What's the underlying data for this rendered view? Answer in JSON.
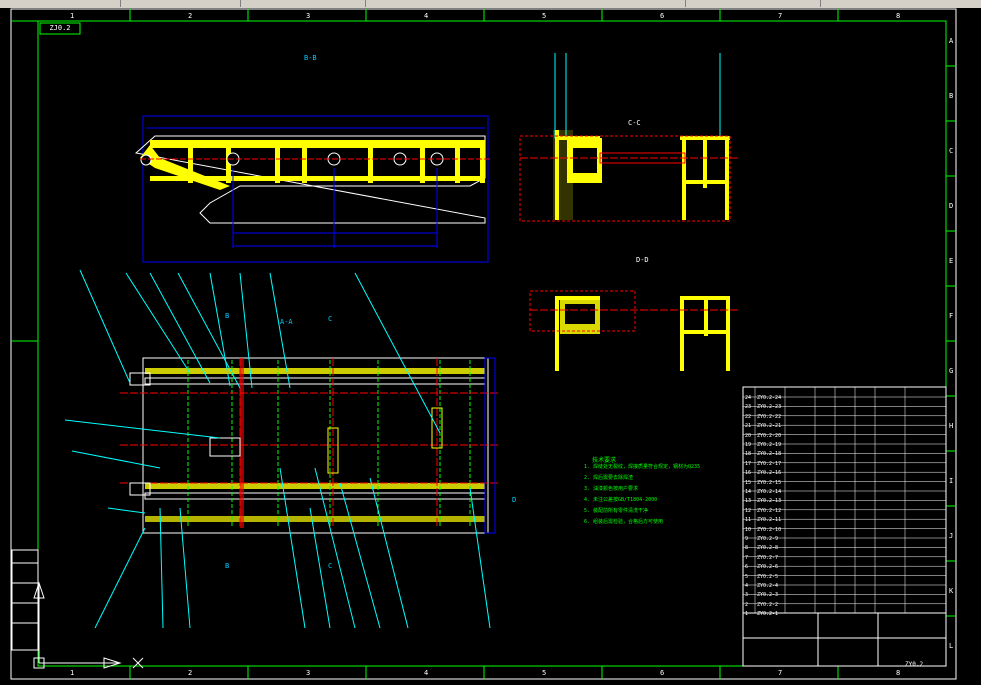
{
  "app": {
    "title": ""
  },
  "border": {
    "top_numbers": [
      "1",
      "2",
      "3",
      "4",
      "5",
      "6",
      "7",
      "8"
    ],
    "bottom_numbers": [
      "1",
      "2",
      "3",
      "4",
      "5",
      "6",
      "7",
      "8"
    ],
    "right_letters": [
      "A",
      "B",
      "C",
      "D",
      "E",
      "F",
      "G",
      "H",
      "I",
      "J",
      "K",
      "L"
    ]
  },
  "title_block": {
    "drawing_code": "ZJ0.2",
    "drawing_number": "ZY0.2"
  },
  "section_labels": {
    "top_left": "B-B",
    "right_top": "C-C",
    "right_mid": "D-D",
    "main": "A-A",
    "marker_b": "B",
    "marker_c": "C",
    "marker_d": "D"
  },
  "notes": {
    "title": "技术要求",
    "lines": [
      "1. 焊缝处无裂纹，焊接质量符合规定，钢材为Q235",
      "2. 焊后需要去除焊渣",
      "3. 油漆颜色按用户要求",
      "4. 未注公差按GB/T1804-2000",
      "5. 装配前所有零件清洗干净",
      "6. 组装后需检验，合格后方可使用"
    ]
  },
  "parts_table": {
    "rows": [
      {
        "no": "24",
        "code": "ZY0.2-24"
      },
      {
        "no": "23",
        "code": "ZY0.2-23"
      },
      {
        "no": "22",
        "code": "ZY0.2-22"
      },
      {
        "no": "21",
        "code": "ZY0.2-21"
      },
      {
        "no": "20",
        "code": "ZY0.2-20"
      },
      {
        "no": "19",
        "code": "ZY0.2-19"
      },
      {
        "no": "18",
        "code": "ZY0.2-18"
      },
      {
        "no": "17",
        "code": "ZY0.2-17"
      },
      {
        "no": "16",
        "code": "ZY0.2-16"
      },
      {
        "no": "15",
        "code": "ZY0.2-15"
      },
      {
        "no": "14",
        "code": "ZY0.2-14"
      },
      {
        "no": "13",
        "code": "ZY0.2-13"
      },
      {
        "no": "12",
        "code": "ZY0.2-12"
      },
      {
        "no": "11",
        "code": "ZY0.2-11"
      },
      {
        "no": "10",
        "code": "ZY0.2-10"
      },
      {
        "no": "9",
        "code": "ZY0.2-9"
      },
      {
        "no": "8",
        "code": "ZY0.2-8"
      },
      {
        "no": "7",
        "code": "ZY0.2-7"
      },
      {
        "no": "6",
        "code": "ZY0.2-6"
      },
      {
        "no": "5",
        "code": "ZY0.2-5"
      },
      {
        "no": "4",
        "code": "ZY0.2-4"
      },
      {
        "no": "3",
        "code": "ZY0.2-3"
      },
      {
        "no": "2",
        "code": "ZY0.2-2"
      },
      {
        "no": "1",
        "code": "ZY0.2-1"
      }
    ]
  },
  "colors": {
    "frame": "#00ff00",
    "outline": "#ffffff",
    "part": "#ffff00",
    "hidden": "#00ffff",
    "center": "#ff0000",
    "dim": "#0000ff"
  }
}
